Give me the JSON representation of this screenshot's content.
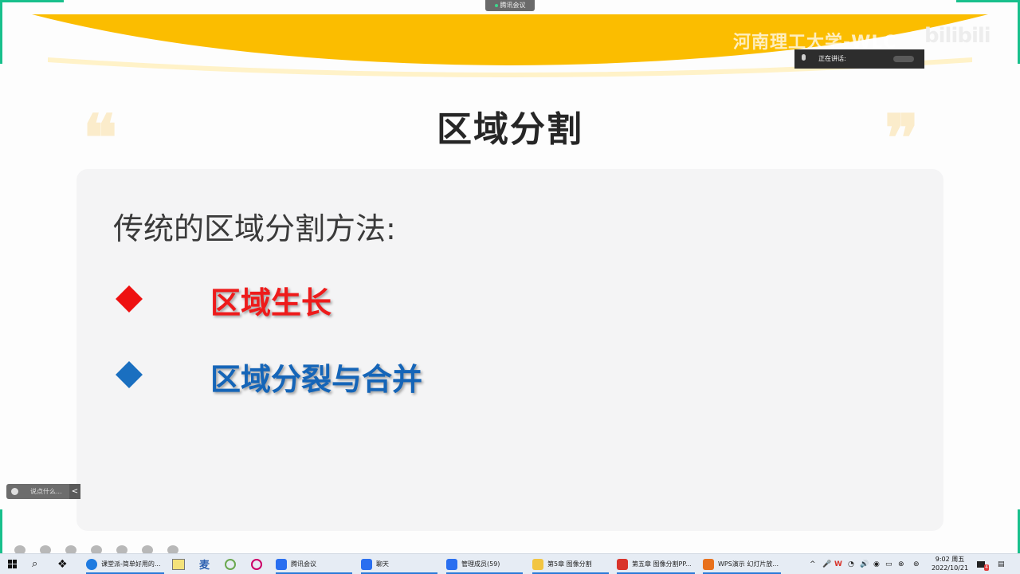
{
  "meeting_bar": {
    "label": "腾讯会议"
  },
  "banner": {
    "school": "河南理工大学-WLC",
    "watermark": "bilibili"
  },
  "speaking": {
    "label": "正在讲话:"
  },
  "slide": {
    "title": "区域分割",
    "subtitle": "传统的区域分割方法:",
    "items": [
      {
        "label": "区域生长",
        "color": "#ee1b1b"
      },
      {
        "label": "区域分裂与合并",
        "color": "#1565b8"
      }
    ],
    "quote_open": "❝",
    "quote_close": "❞"
  },
  "chat": {
    "placeholder": "说点什么...",
    "toggle": "<"
  },
  "taskbar": {
    "apps": [
      {
        "label": "课堂派-简单好用的...",
        "color": "#1f7be0"
      },
      {
        "label": "腾讯会议",
        "color": "#2a6ff0"
      },
      {
        "label": "聊天",
        "color": "#2a6ff0"
      },
      {
        "label": "管理成员(59)",
        "color": "#2a6ff0"
      },
      {
        "label": "第5章 图像分割",
        "color": "#f2c542"
      },
      {
        "label": "第五章 图像分割PP...",
        "color": "#d9342b"
      },
      {
        "label": "WPS演示 幻灯片放...",
        "color": "#e8711c"
      }
    ],
    "clock": {
      "time": "9:02 周五",
      "date": "2022/10/21"
    },
    "notification_count": "4"
  }
}
